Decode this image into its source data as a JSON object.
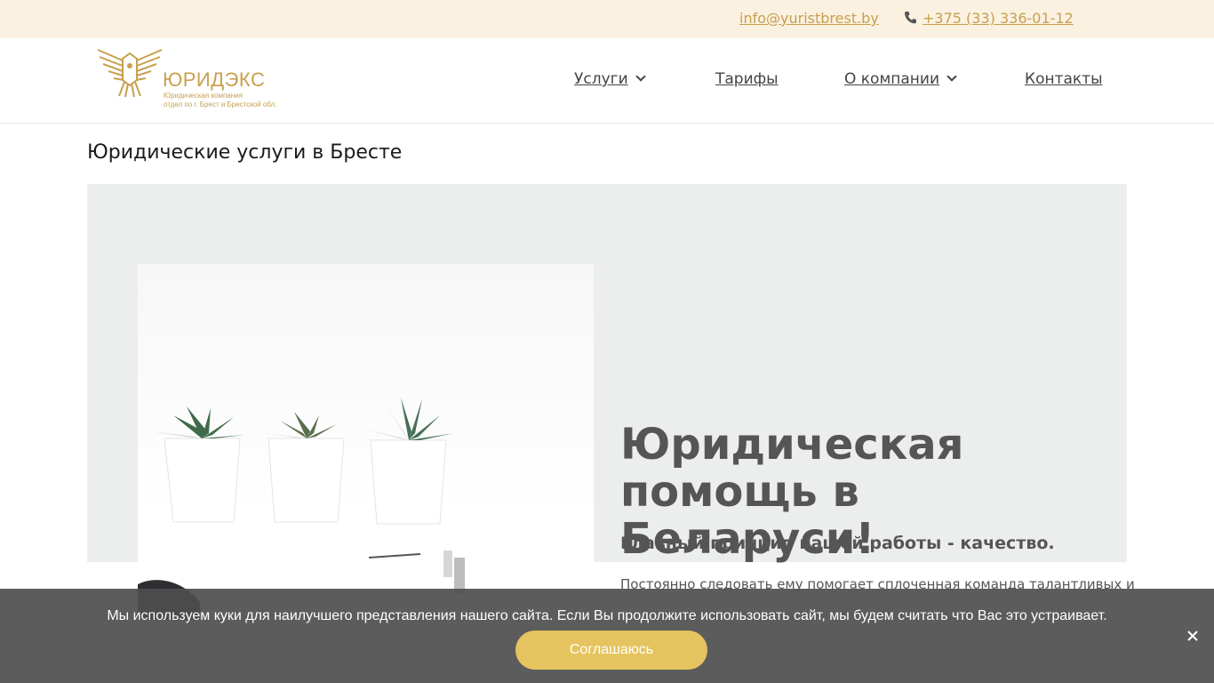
{
  "topbar": {
    "email": "info@yuristbrest.by",
    "phone": "+375 (33) 336-01-12",
    "phone_icon": "phone-icon"
  },
  "header": {
    "logo": {
      "brand": "ЮРИДЭКС",
      "tagline_1": "Юридическая компания",
      "tagline_2": "отдел по г. Брест и Брестской обл."
    },
    "nav": [
      {
        "label": "Услуги",
        "dropdown": true
      },
      {
        "label": "Тарифы",
        "dropdown": false
      },
      {
        "label": "О компании",
        "dropdown": true
      },
      {
        "label": "Контакты",
        "dropdown": false
      }
    ]
  },
  "page": {
    "title": "Юридические услуги в Бресте"
  },
  "hero": {
    "heading": "Юридическая помощь в Беларуси!",
    "subheading": "Главный принцип нашей работы - качество.",
    "body": "Постоянно следовать ему помогает сплоченная команда талантливых и"
  },
  "cookie": {
    "message": "Мы используем куки для наилучшего представления нашего сайта. Если Вы продолжите использовать сайт, мы будем считать что Вас это устраивает.",
    "accept_label": "Соглашаюсь",
    "close_icon": "close-icon"
  },
  "colors": {
    "accent_gold": "#c8a04e",
    "topbar_bg": "#faf1e1",
    "hero_bg": "#eceeed",
    "button_gold": "#e5c45f"
  }
}
